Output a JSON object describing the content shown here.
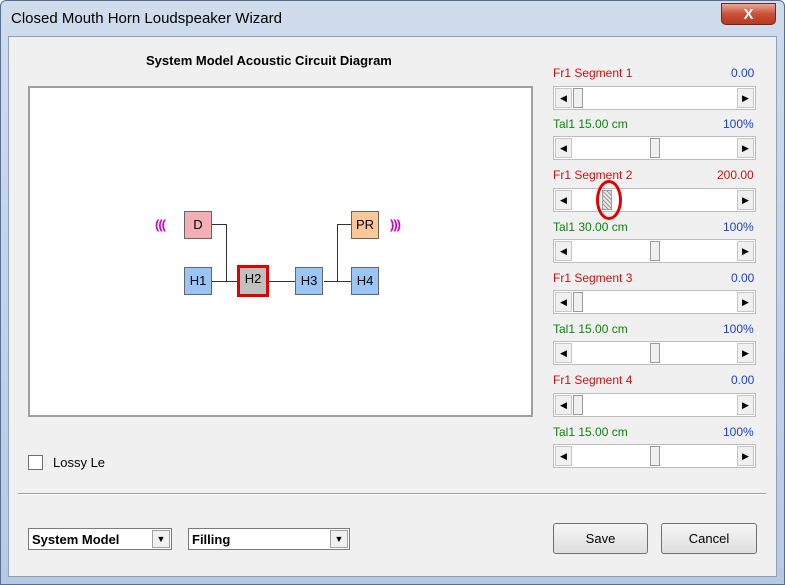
{
  "window": {
    "title": "Closed Mouth Horn Loudspeaker Wizard",
    "close_label": "X"
  },
  "diagram": {
    "title": "System Model Acoustic Circuit Diagram",
    "blocks": {
      "d": "D",
      "pr": "PR",
      "h1": "H1",
      "h2": "H2",
      "h3": "H3",
      "h4": "H4"
    },
    "wave_left": "(((",
    "wave_right": ")))"
  },
  "lossy_label": "Lossy Le",
  "dropdowns": {
    "model": "System Model",
    "filling": "Filling"
  },
  "buttons": {
    "save": "Save",
    "cancel": "Cancel"
  },
  "segments": [
    {
      "fr_label": "Fr1  Segment 1",
      "fr_value": "0.00",
      "tal_label": "Tal1  15.00 cm",
      "tal_value": "100%"
    },
    {
      "fr_label": "Fr1  Segment 2",
      "fr_value": "200.00",
      "tal_label": "Tal1  30.00 cm",
      "tal_value": "100%"
    },
    {
      "fr_label": "Fr1  Segment 3",
      "fr_value": "0.00",
      "tal_label": "Tal1  15.00 cm",
      "tal_value": "100%"
    },
    {
      "fr_label": "Fr1  Segment 4",
      "fr_value": "0.00",
      "tal_label": "Tal1  15.00 cm",
      "tal_value": "100%"
    }
  ],
  "colors": {
    "fr_label": "#d01010",
    "tal_label": "#108010",
    "value": "#2040d0",
    "highlight": "#e00000"
  }
}
